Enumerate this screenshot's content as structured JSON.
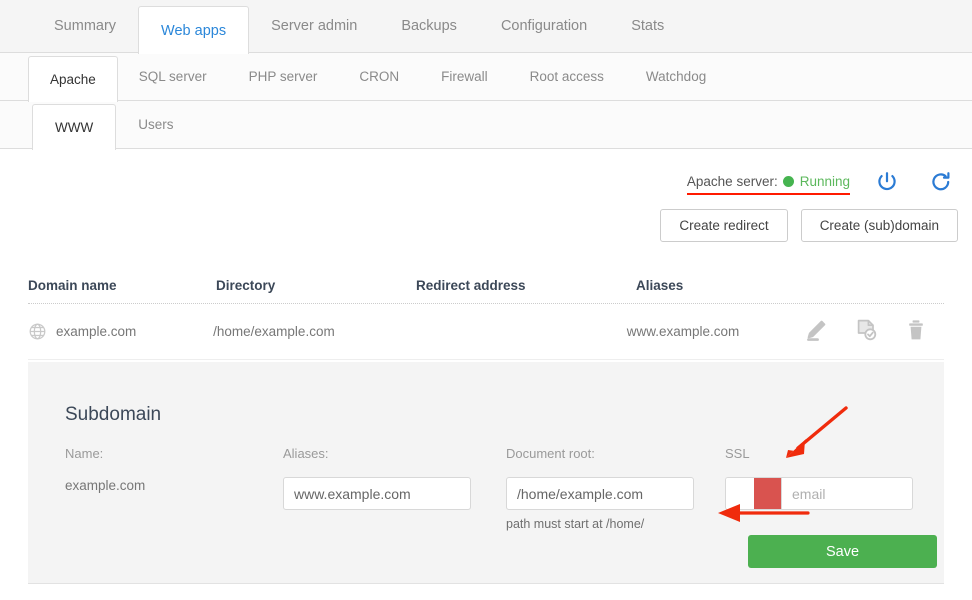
{
  "tabs_primary": [
    {
      "label": "Summary",
      "active": false
    },
    {
      "label": "Web apps",
      "active": true
    },
    {
      "label": "Server admin",
      "active": false
    },
    {
      "label": "Backups",
      "active": false
    },
    {
      "label": "Configuration",
      "active": false
    },
    {
      "label": "Stats",
      "active": false
    }
  ],
  "tabs_secondary": [
    {
      "label": "Apache",
      "active": true
    },
    {
      "label": "SQL server",
      "active": false
    },
    {
      "label": "PHP server",
      "active": false
    },
    {
      "label": "CRON",
      "active": false
    },
    {
      "label": "Firewall",
      "active": false
    },
    {
      "label": "Root access",
      "active": false
    },
    {
      "label": "Watchdog",
      "active": false
    }
  ],
  "tabs_tertiary": [
    {
      "label": "WWW",
      "active": true
    },
    {
      "label": "Users",
      "active": false
    }
  ],
  "status": {
    "label": "Apache server:",
    "value": "Running",
    "dot_color": "#46b450",
    "value_color": "#5cb85c",
    "power_icon": "power-icon",
    "restart_icon": "restart-icon",
    "icon_color": "#2b7bd4"
  },
  "actions": {
    "create_redirect": "Create redirect",
    "create_subdomain": "Create (sub)domain"
  },
  "table": {
    "headers": [
      "Domain name",
      "Directory",
      "Redirect address",
      "Aliases"
    ],
    "rows": [
      {
        "domain": "example.com",
        "directory": "/home/example.com",
        "redirect": "",
        "aliases": "www.example.com",
        "icons": [
          "edit-icon",
          "certificate-icon",
          "delete-icon"
        ]
      }
    ]
  },
  "panel": {
    "title": "Subdomain",
    "name_label": "Name:",
    "name_value": "example.com",
    "aliases_label": "Aliases:",
    "aliases_value": "www.example.com",
    "aliases_placeholder": "",
    "docroot_label": "Document root:",
    "docroot_value": "/home/example.com",
    "docroot_hint": "path must start at /home/",
    "ssl_label": "SSL",
    "ssl_toggle_state": "off",
    "ssl_toggle_color": "#d9534f",
    "ssl_email_value": "",
    "ssl_email_placeholder": "email",
    "save_label": "Save",
    "save_color": "#4cb050"
  },
  "annotations": {
    "underline_color": "#ff1a00",
    "arrow_color": "#f02b0c",
    "diagonal_arrow": "points at SSL toggle",
    "horizontal_arrow": "points left below SSL toggle"
  }
}
